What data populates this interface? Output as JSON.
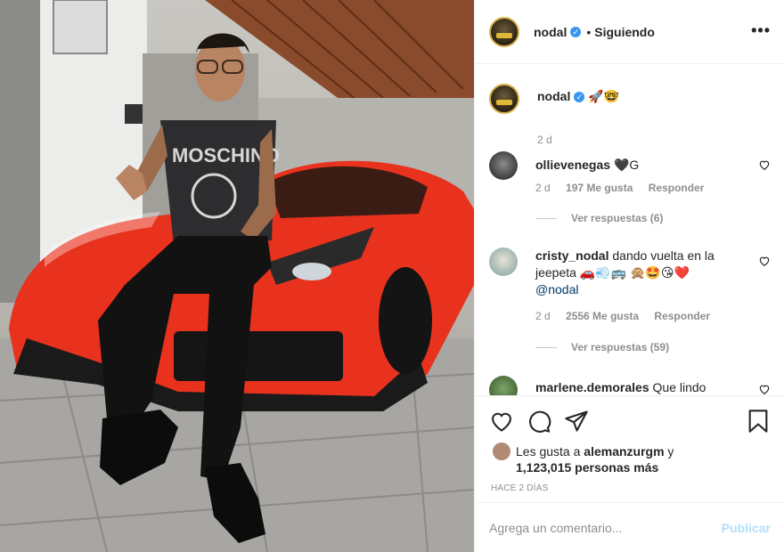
{
  "header": {
    "username": "nodal",
    "verified_mark": "✓",
    "separator": "•",
    "follow_status": "Siguiendo",
    "more_label": "•••"
  },
  "caption": {
    "username": "nodal",
    "text": "🚀🤓",
    "time": "2 d"
  },
  "comments": [
    {
      "username": "ollievenegas",
      "text": "🖤G",
      "time": "2 d",
      "likes": "197 Me gusta",
      "reply": "Responder",
      "view_replies": "Ver respuestas (6)"
    },
    {
      "username": "cristy_nodal",
      "text": "dando vuelta en la jeepeta 🚗💨🚌 🙊🤩😘❤️",
      "mention": "@nodal",
      "time": "2 d",
      "likes": "2556 Me gusta",
      "reply": "Responder",
      "view_replies": "Ver respuestas (59)"
    },
    {
      "username": "marlene.demorales",
      "text": "Que lindo"
    }
  ],
  "likes": {
    "prefix": "Les gusta a",
    "user": "alemanzurgm",
    "suffix": "y",
    "count": "1,123,015 personas más"
  },
  "posted_ago": "HACE 2 DÍAS",
  "comment_box": {
    "placeholder": "Agrega un comentario...",
    "publish_label": "Publicar"
  },
  "colors": {
    "verified": "#3897f0",
    "publish_disabled": "#b2dffc",
    "car": "#e8321e"
  },
  "icons": [
    "heart-icon",
    "comment-icon",
    "share-icon",
    "bookmark-icon",
    "more-icon"
  ]
}
